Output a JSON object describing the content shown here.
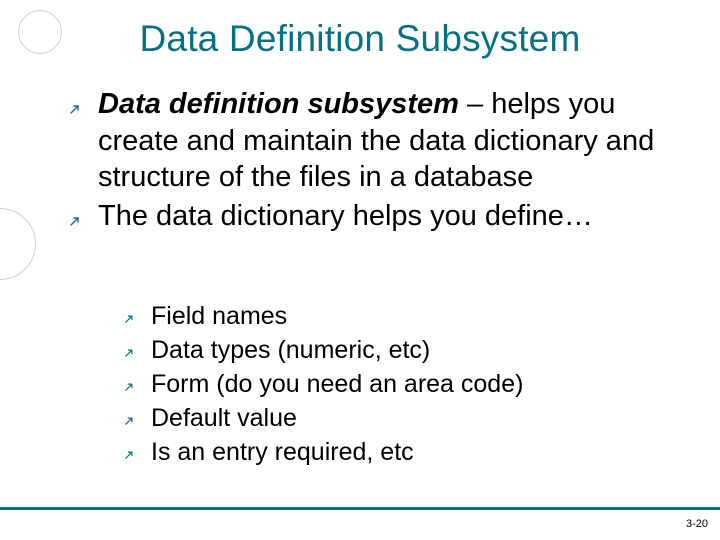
{
  "title": "Data Definition Subsystem",
  "bullets": {
    "main": [
      {
        "bold": "Data definition subsystem",
        "rest": " – helps you create and maintain the data dictionary and structure of the files in a database"
      },
      {
        "bold": "",
        "rest": "The data dictionary helps you define…"
      }
    ],
    "sub": [
      "Field names",
      "Data types (numeric, etc)",
      "Form (do you need an area code)",
      "Default value",
      "Is an entry required, etc"
    ]
  },
  "slide_number": "3-20",
  "colors": {
    "accent": "#087386"
  }
}
